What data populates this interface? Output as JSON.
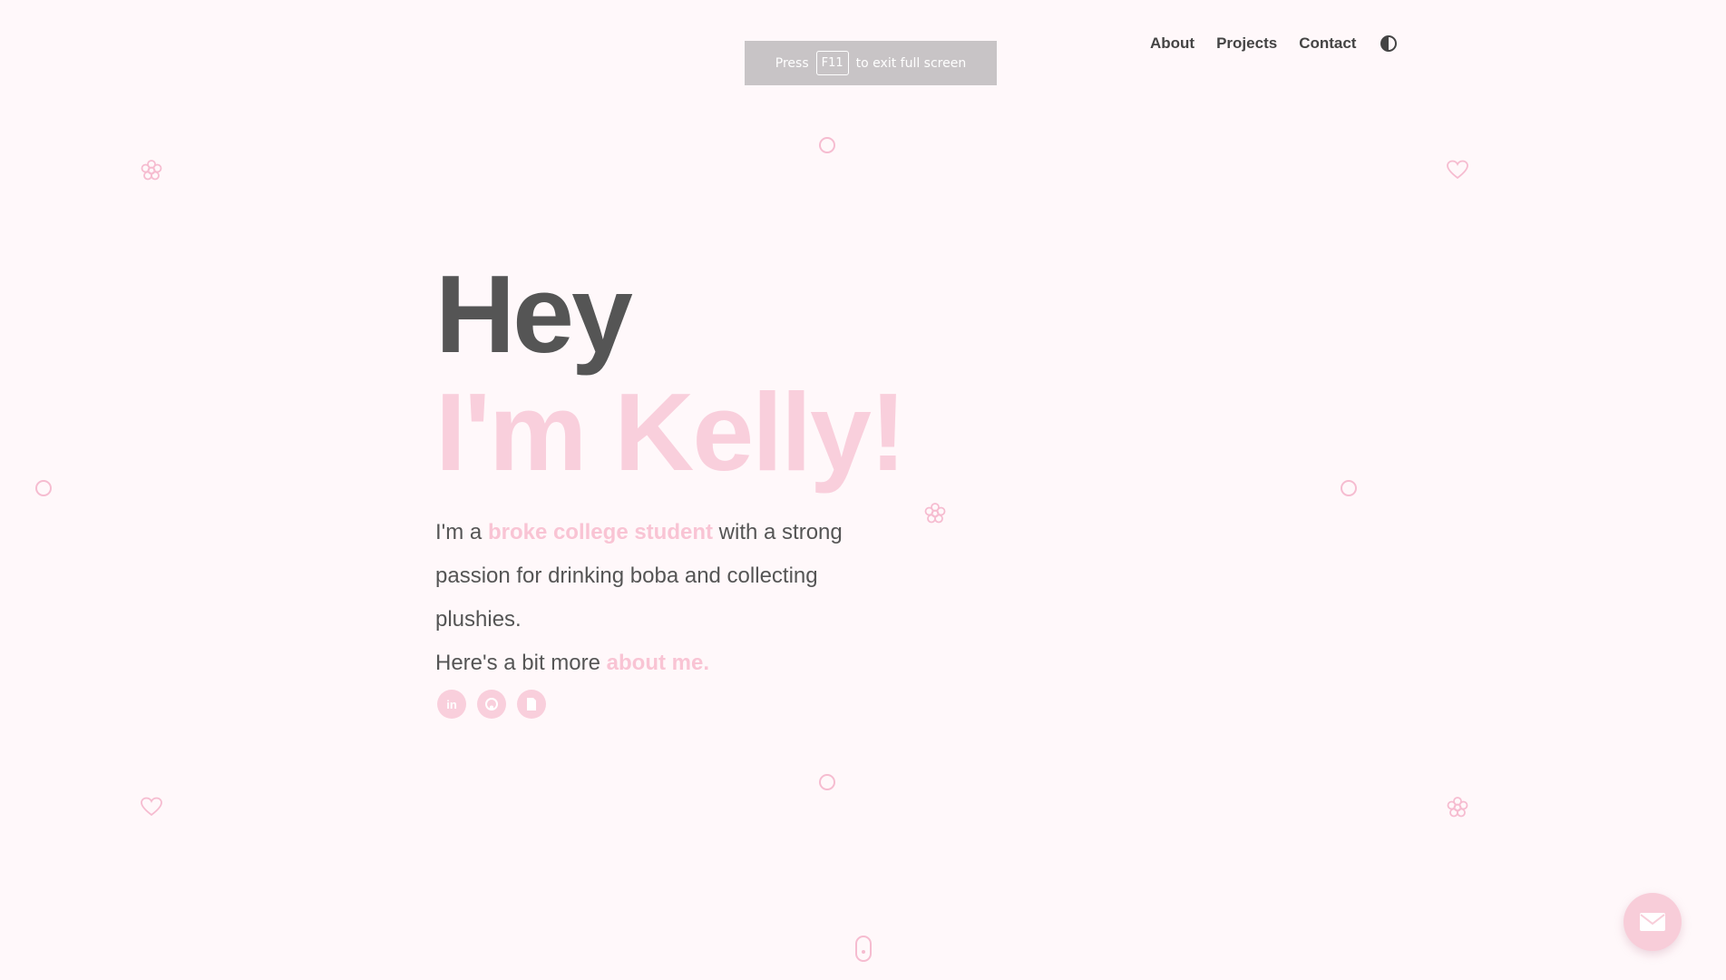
{
  "fullscreen_notice": {
    "press": "Press",
    "key": "F11",
    "suffix": "to exit full screen"
  },
  "nav": {
    "items": [
      "About",
      "Projects",
      "Contact"
    ],
    "theme_toggle_icon": "half-circle-contrast-icon"
  },
  "hero": {
    "greeting": "Hey",
    "name": "I'm Kelly!",
    "desc_prefix": "I'm a ",
    "desc_highlight": "broke college student",
    "desc_rest": " with a strong passion for drinking boba and collecting plushies.",
    "more_prefix": "Here's a bit more ",
    "more_link": "about me."
  },
  "socials": [
    {
      "icon": "linkedin-icon",
      "glyph": "in"
    },
    {
      "icon": "github-icon"
    },
    {
      "icon": "resume-document-icon"
    }
  ],
  "colors": {
    "background": "#fff8fa",
    "accent_pink": "#f9cfdc",
    "text_gray": "#555555",
    "decoration_pink": "#f6bcd0"
  },
  "mail_fab": {
    "icon": "envelope-icon"
  }
}
